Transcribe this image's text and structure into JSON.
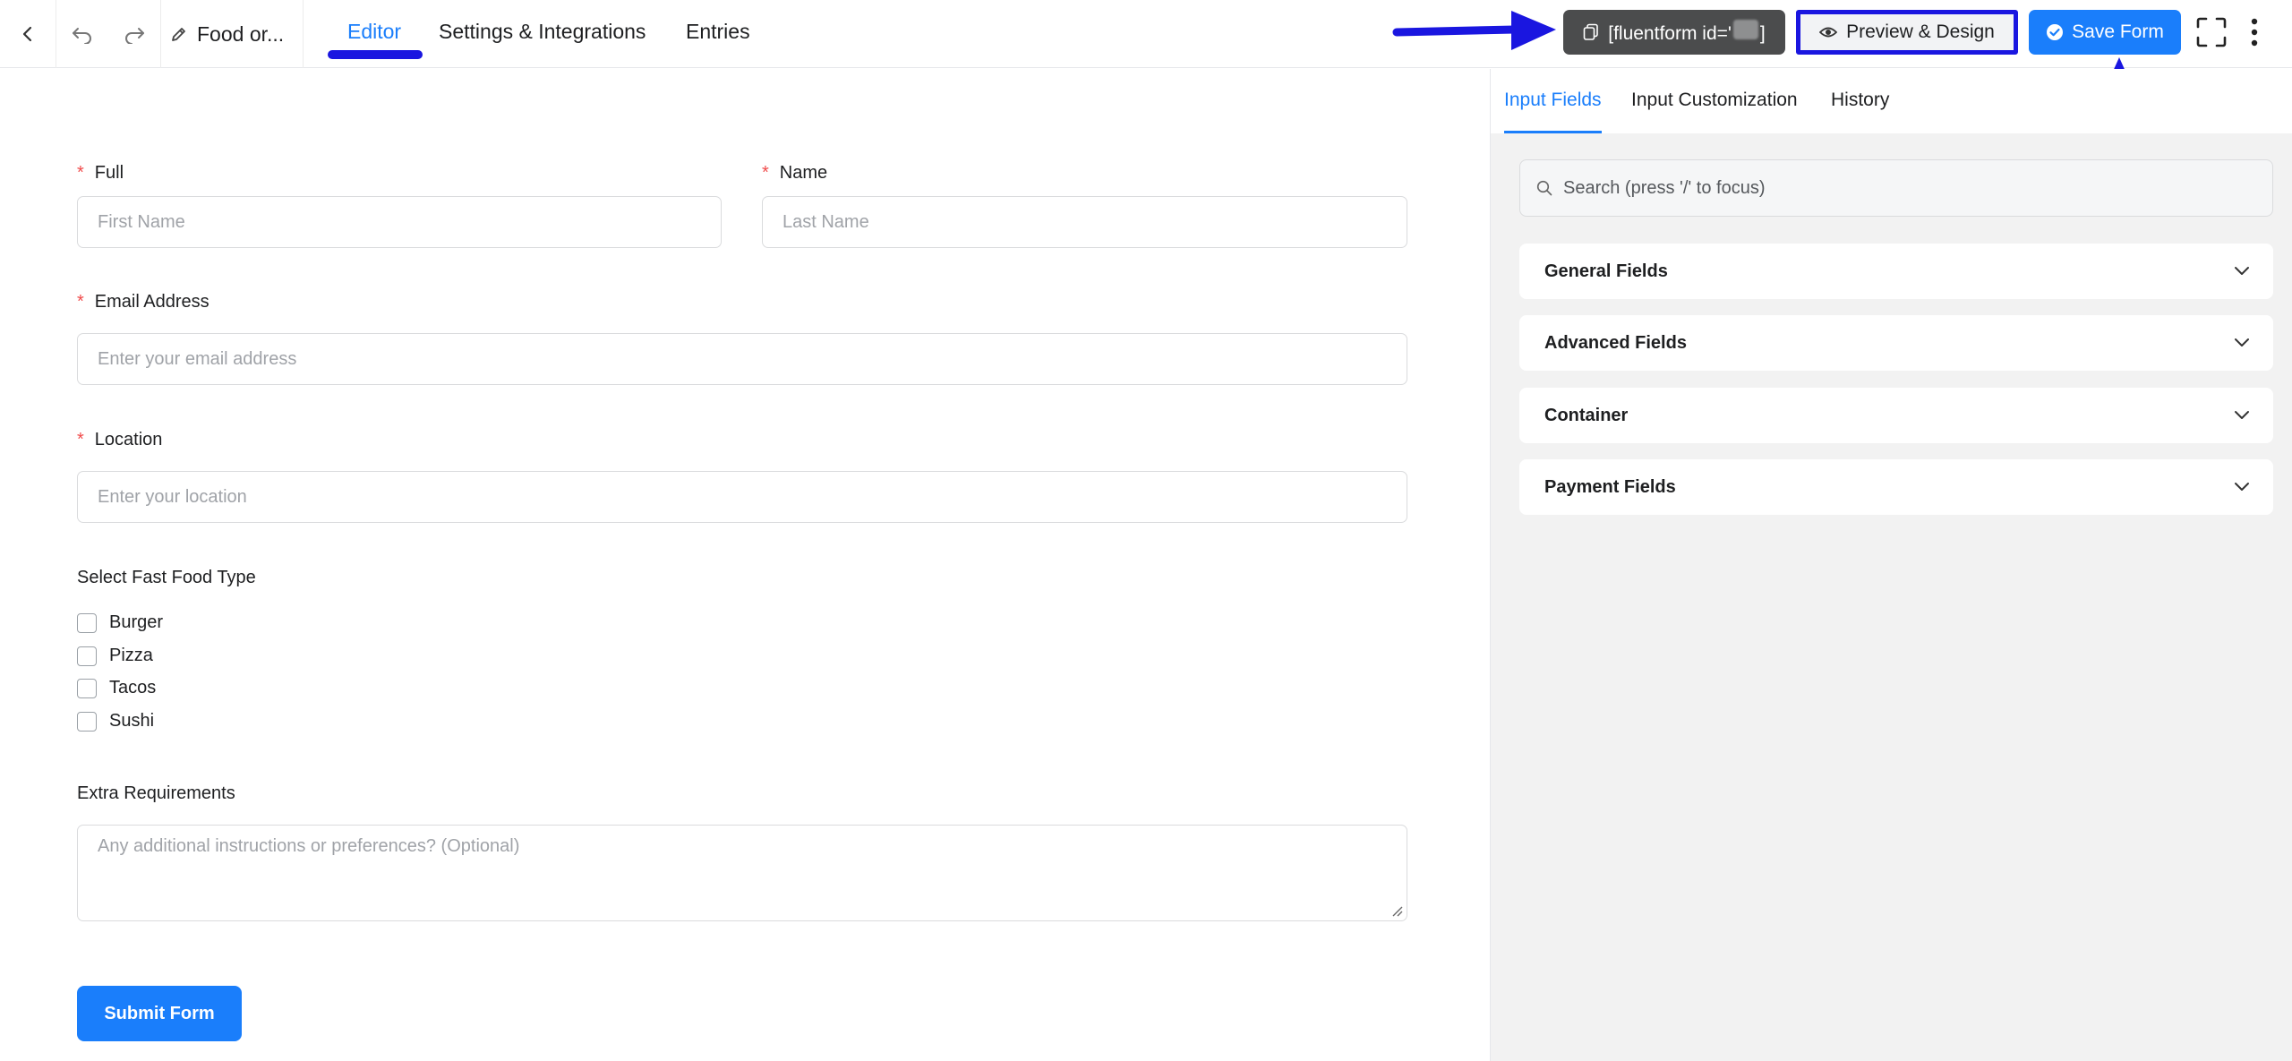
{
  "header": {
    "form_name": "Food or...",
    "tabs": [
      {
        "label": "Editor",
        "active": true
      },
      {
        "label": "Settings & Integrations",
        "active": false
      },
      {
        "label": "Entries",
        "active": false
      }
    ],
    "shortcode_prefix": "[fluentform id='",
    "shortcode_suffix": "]",
    "preview_label": "Preview & Design",
    "save_label": "Save Form"
  },
  "form": {
    "first_name": {
      "label": "Full",
      "required": true,
      "placeholder": "First Name"
    },
    "last_name": {
      "label": "Name",
      "required": true,
      "placeholder": "Last Name"
    },
    "email": {
      "label": "Email Address",
      "required": true,
      "placeholder": "Enter your email address"
    },
    "location": {
      "label": "Location",
      "required": true,
      "placeholder": "Enter your location"
    },
    "food_type": {
      "label": "Select Fast Food Type",
      "options": [
        "Burger",
        "Pizza",
        "Tacos",
        "Sushi"
      ]
    },
    "extra": {
      "label": "Extra Requirements",
      "placeholder": "Any additional instructions or preferences? (Optional)"
    },
    "submit_label": "Submit Form",
    "required_marker": "*"
  },
  "sidebar": {
    "tabs": [
      {
        "label": "Input Fields",
        "active": true
      },
      {
        "label": "Input Customization",
        "active": false
      },
      {
        "label": "History",
        "active": false
      }
    ],
    "search_placeholder": "Search (press '/' to focus)",
    "panels": [
      {
        "label": "General Fields"
      },
      {
        "label": "Advanced Fields"
      },
      {
        "label": "Container"
      },
      {
        "label": "Payment Fields"
      }
    ]
  },
  "colors": {
    "accent": "#1a7efb",
    "annotation": "#1a16e0",
    "required": "#f04c4c",
    "shortcode_bg": "#4b4c4d"
  },
  "icons": [
    "back-icon",
    "undo-icon",
    "redo-icon",
    "edit-icon",
    "copy-icon",
    "eye-icon",
    "check-circle-icon",
    "fullscreen-icon",
    "more-vertical-icon",
    "search-icon",
    "chevron-down-icon"
  ]
}
